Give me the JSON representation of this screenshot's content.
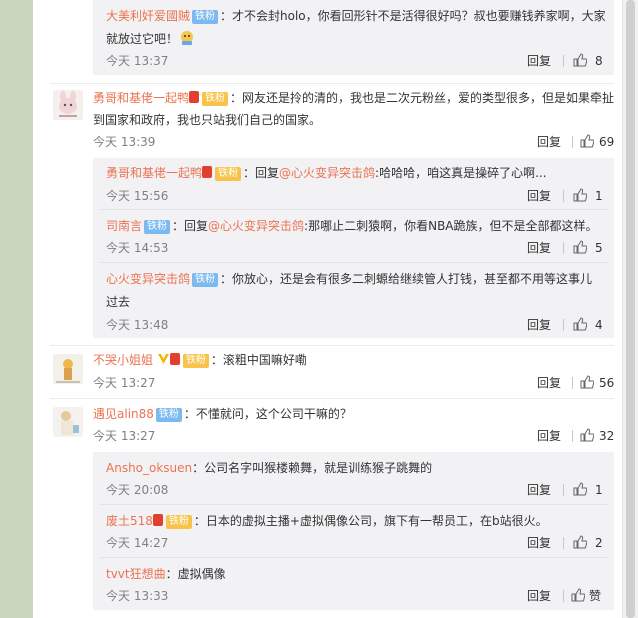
{
  "comments": [
    {
      "user": "大美利奸爱國贼",
      "tag": "铁粉",
      "text_line1": "：才不会封holo，你看回形针不是活得很好吗？叔也要赚钱养家啊，大家",
      "text_line2": "就放过它吧！",
      "time": "今天 13:37",
      "reply": "回复",
      "likes": "8"
    },
    {
      "user": "勇哥和基佬一起鸭",
      "tag": "铁粉",
      "text_line1": "：网友还是拎的清的，我也是二次元粉丝，爱的类型很多，但是如果牵扯",
      "text_line2": "到国家和政府，我也只站我们自己的国家。",
      "time": "今天 13:39",
      "reply": "回复",
      "likes": "69",
      "replies": [
        {
          "user": "勇哥和基佬一起鸭",
          "tag": "铁粉",
          "prefix": "：回复",
          "target": "@心火变异突击鸽",
          "text": ":哈哈哈，咱这真是操碎了心啊...",
          "time": "今天 15:56",
          "reply": "回复",
          "likes": "1"
        },
        {
          "user": "司南言",
          "tag": "铁粉",
          "prefix": "：回复",
          "target": "@心火变异突击鸽",
          "text": ":那哪止二刺猿啊，你看NBA跪族，但不是全部都这样。",
          "time": "今天 14:53",
          "reply": "回复",
          "likes": "5"
        },
        {
          "user": "心火变异突击鸽",
          "tag": "铁粉",
          "text_line1": "：你放心，还是会有很多二刺螈给继续管人打钱，甚至都不用等这事儿",
          "text_line2": "过去",
          "time": "今天 13:48",
          "reply": "回复",
          "likes": "4"
        }
      ]
    },
    {
      "user": "不哭小姐姐",
      "tag": "铁粉",
      "text_line1": "：滚粗中国嘛好嘞",
      "time": "今天 13:27",
      "reply": "回复",
      "likes": "56"
    },
    {
      "user": "遇见alin88",
      "tag": "铁粉",
      "text_line1": "：不懂就问，这个公司干嘛的？",
      "time": "今天 13:27",
      "reply": "回复",
      "likes": "32",
      "replies": [
        {
          "user": "Ansho_oksuen",
          "text": "：公司名字叫猴楼赖舞，就是训练猴子跳舞的",
          "time": "今天 20:08",
          "reply": "回复",
          "likes": "1"
        },
        {
          "user": "废土518",
          "tag": "铁粉",
          "text": "：日本的虚拟主播+虚拟偶像公司，旗下有一帮员工，在b站很火。",
          "time": "今天 14:27",
          "reply": "回复",
          "likes": "2"
        },
        {
          "user": "tvvt狂想曲",
          "text": "：虚拟偶像",
          "time": "今天 13:33",
          "reply": "回复",
          "likes": "赞"
        }
      ]
    }
  ],
  "colors": {
    "username": "#eb7350",
    "tag_blue": "#7bbaf0",
    "tag_gold": "#f7c34a",
    "reply_bg": "#f2f2f5",
    "page_bg": "#c9d7be"
  }
}
